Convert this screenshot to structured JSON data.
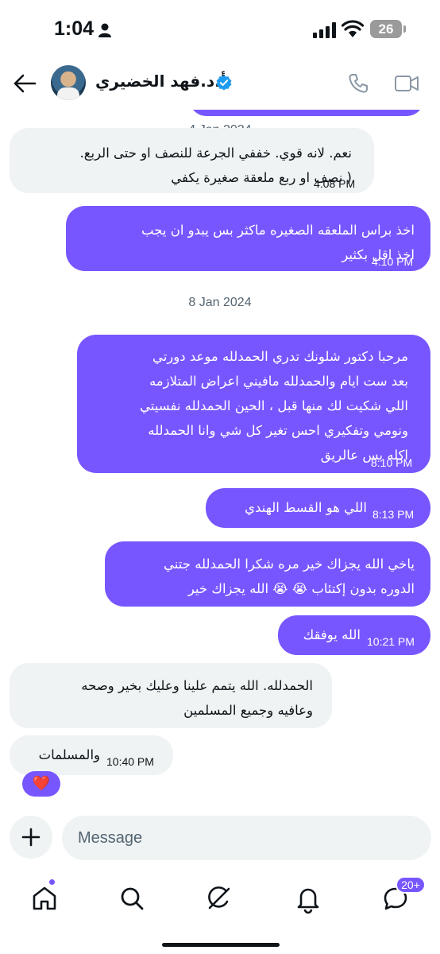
{
  "status_bar": {
    "time": "1:04",
    "battery": "26"
  },
  "header": {
    "contact_name": "أ.د.فهد الخضيري"
  },
  "dates": [
    "4 Jan 2024",
    "8 Jan 2024"
  ],
  "messages": [
    {
      "dir": "in",
      "lines": [
        "نعم. لانه قوي.  خففي الجرعة للنصف او حتى الربع.",
        "( نصف او ربع ملعقة صغيرة يكفي"
      ],
      "time": "4:08 PM"
    },
    {
      "dir": "out",
      "lines": [
        "اخذ براس الملعقه الصغيره ماكثر  بس يبدو ان يجب",
        "اخذ اقل بكثير"
      ],
      "time": "4:10 PM"
    },
    {
      "dir": "out",
      "lines": [
        "مرحبا دكتور شلونك تدري الحمدلله  موعد دورتي",
        "بعد ست ايام والحمدلله مافيني اعراض المتلازمه",
        "اللي شكيت لك منها قبل ، الحين الحمدلله نفسيتي",
        "ونومي وتفكيري احس تغير كل شي وانا الحمدلله",
        "اكله بس عالريق"
      ],
      "time": "8:10 PM"
    },
    {
      "dir": "out",
      "lines": [
        "اللي هو القسط الهندي"
      ],
      "time": "8:13 PM"
    },
    {
      "dir": "out",
      "lines": [
        "ياخي الله يجزاك خير مره شكرا الحمدلله جتني",
        "الدوره بدون إكتئاب 😭 😭 الله يجزاك خير"
      ],
      "time": ""
    },
    {
      "dir": "out",
      "lines": [
        "الله يوفقك"
      ],
      "time": "10:21 PM"
    },
    {
      "dir": "in",
      "lines": [
        "الحمدلله.  الله يتمم علينا وعليك بخير وصحه",
        "وعافيه  وجميع المسلمين"
      ],
      "time": ""
    },
    {
      "dir": "in",
      "lines": [
        "والمسلمات"
      ],
      "time": "10:40 PM"
    }
  ],
  "reaction": "❤️",
  "compose": {
    "placeholder": "Message",
    "add_label": "+"
  },
  "nav": {
    "messages_badge": "20+"
  },
  "icons": [
    "back-icon",
    "verified-icon",
    "phone-icon",
    "video-icon",
    "add-icon",
    "home-icon",
    "search-icon",
    "grok-icon",
    "bell-icon",
    "messages-icon"
  ],
  "colors": {
    "accent": "#7856ff",
    "incoming": "#eff3f4",
    "verified": "#1d9bf0"
  }
}
